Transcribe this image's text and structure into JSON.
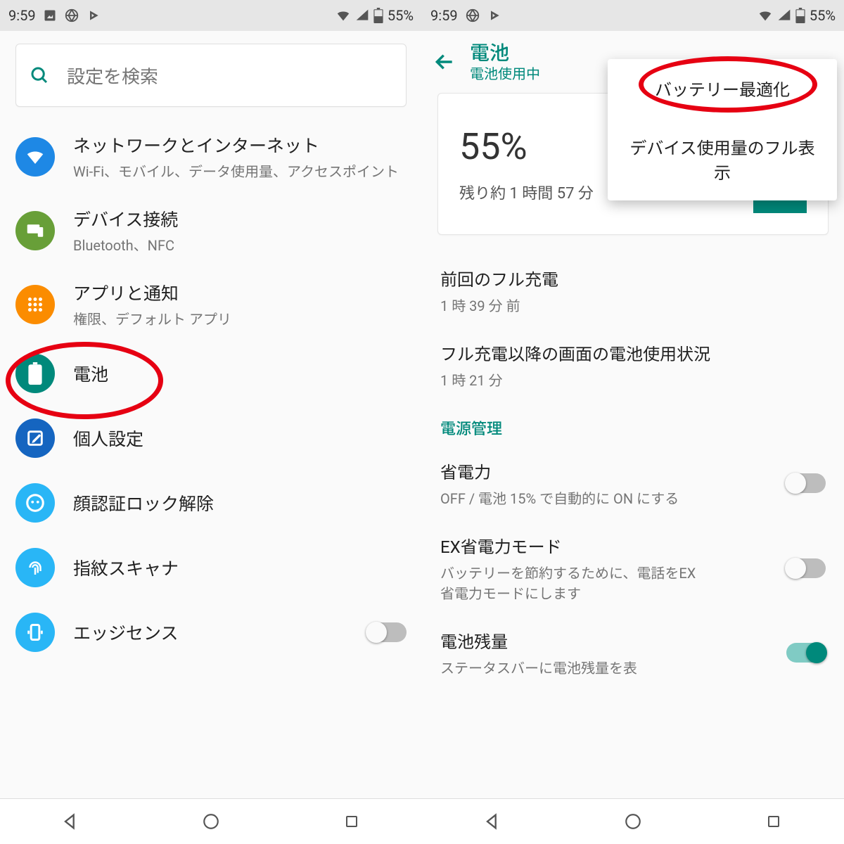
{
  "status": {
    "time": "9:59",
    "battery": "55%"
  },
  "search": {
    "placeholder": "設定を検索"
  },
  "settings": [
    {
      "icon": "wifi",
      "color": "#1e88e5",
      "title": "ネットワークとインターネット",
      "sub": "Wi-Fi、モバイル、データ使用量、アクセスポイント"
    },
    {
      "icon": "devices",
      "color": "#689f38",
      "title": "デバイス接続",
      "sub": "Bluetooth、NFC"
    },
    {
      "icon": "apps",
      "color": "#fb8c00",
      "title": "アプリと通知",
      "sub": "権限、デフォルト アプリ"
    },
    {
      "icon": "battery",
      "color": "#00897b",
      "title": "電池",
      "sub": ""
    },
    {
      "icon": "edit",
      "color": "#1565c0",
      "title": "個人設定",
      "sub": ""
    },
    {
      "icon": "face",
      "color": "#29b6f6",
      "title": "顔認証ロック解除",
      "sub": ""
    },
    {
      "icon": "fingerprint",
      "color": "#29b6f6",
      "title": "指紋スキャナ",
      "sub": ""
    },
    {
      "icon": "edge",
      "color": "#29b6f6",
      "title": "エッジセンス",
      "sub": "",
      "toggle": "off"
    }
  ],
  "battery_page": {
    "header_title": "電池",
    "header_sub": "電池使用中",
    "percent": "55%",
    "remaining": "残り約 1 時間 57 分",
    "rows": [
      {
        "title": "前回のフル充電",
        "sub": "1 時 39 分 前"
      },
      {
        "title": "フル充電以降の画面の電池使用状況",
        "sub": "1 時 21 分"
      }
    ],
    "section": "電源管理",
    "toggles": [
      {
        "title": "省電力",
        "sub": "OFF / 電池 15% で自動的に ON にする",
        "on": false
      },
      {
        "title": "EX省電力モード",
        "sub": "バッテリーを節約するために、電話をEX省電力モードにします",
        "on": false
      },
      {
        "title": "電池残量",
        "sub": "ステータスバーに電池残量を表",
        "on": true
      }
    ],
    "menu": [
      "バッテリー最適化",
      "デバイス使用量のフル表示"
    ]
  },
  "icons": {
    "network": "▼",
    "devices": "⎚",
    "apps": "⋮⋮⋮",
    "battery": "▮",
    "edit": "✎",
    "face": "☺",
    "fingerprint": "◉",
    "edge": "▣"
  }
}
